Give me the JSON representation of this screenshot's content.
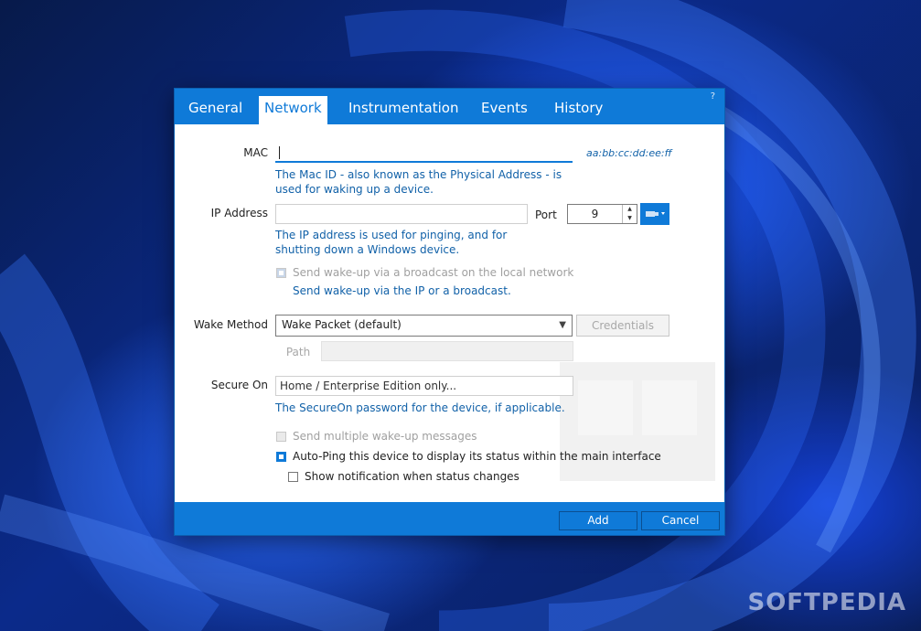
{
  "dialog": {
    "help": "?",
    "tabs": [
      {
        "label": "General"
      },
      {
        "label": "Network",
        "active": true
      },
      {
        "label": "Instrumentation"
      },
      {
        "label": "Events"
      },
      {
        "label": "History"
      }
    ]
  },
  "mac": {
    "label": "MAC",
    "value": "",
    "hint": "aa:bb:cc:dd:ee:ff",
    "description": "The Mac ID - also known as the Physical Address - is used for waking up a device."
  },
  "ip": {
    "label": "IP Address",
    "value": "",
    "description": "The IP address is used for pinging, and for shutting down a Windows device.",
    "port_label": "Port",
    "port_value": "9"
  },
  "broadcast": {
    "checkbox_label": "Send wake-up via a broadcast on the local network",
    "checked": true,
    "disabled": true,
    "description": "Send wake-up via the IP or a broadcast."
  },
  "wake": {
    "label": "Wake Method",
    "selected": "Wake Packet (default)",
    "credentials_label": "Credentials",
    "path_label": "Path",
    "path_value": ""
  },
  "secure": {
    "label": "Secure On",
    "value": "Home / Enterprise Edition only...",
    "description": "The SecureOn password for the device, if applicable."
  },
  "options": {
    "multiple_label": "Send multiple wake-up messages",
    "autoping_label": "Auto-Ping this device to display its status within the main interface",
    "notify_label": "Show notification when status changes"
  },
  "footer": {
    "add_label": "Add",
    "cancel_label": "Cancel"
  },
  "watermark": "SOFTPEDIA",
  "colors": {
    "accent": "#0f7ad8",
    "link_text": "#1161a8",
    "wallpaper": "#0a1f5c"
  }
}
